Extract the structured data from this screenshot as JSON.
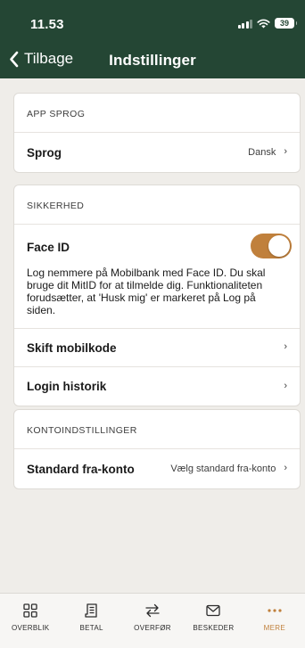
{
  "status": {
    "time": "11.53",
    "battery": "39"
  },
  "nav": {
    "back_label": "Tilbage",
    "title": "Indstillinger"
  },
  "app_language": {
    "section_label": "APP SPROG",
    "language": {
      "label": "Sprog",
      "value": "Dansk"
    }
  },
  "security": {
    "section_label": "SIKKERHED",
    "face_id": {
      "label": "Face ID",
      "enabled": true,
      "description": "Log nemmere på Mobilbank med Face ID. Du skal bruge dit MitID for at tilmelde dig. Funktionaliteten forudsætter, at 'Husk mig' er markeret på Log på siden."
    },
    "change_code": {
      "label": "Skift mobilkode"
    },
    "login_history": {
      "label": "Login historik"
    }
  },
  "account_settings": {
    "section_label": "KONTOINDSTILLINGER",
    "default_account": {
      "label": "Standard fra-konto",
      "value": "Vælg standard fra-konto"
    }
  },
  "chevron": "›",
  "tabbar": {
    "items": [
      {
        "label": "OVERBLIK",
        "icon": "grid-icon"
      },
      {
        "label": "BETAL",
        "icon": "receipt-icon"
      },
      {
        "label": "OVERFØR",
        "icon": "transfer-icon"
      },
      {
        "label": "BESKEDER",
        "icon": "mail-icon"
      },
      {
        "label": "MERE",
        "icon": "more-icon",
        "active": true
      }
    ]
  },
  "colors": {
    "header": "#244634",
    "accent": "#c0803c",
    "background": "#efede9"
  }
}
